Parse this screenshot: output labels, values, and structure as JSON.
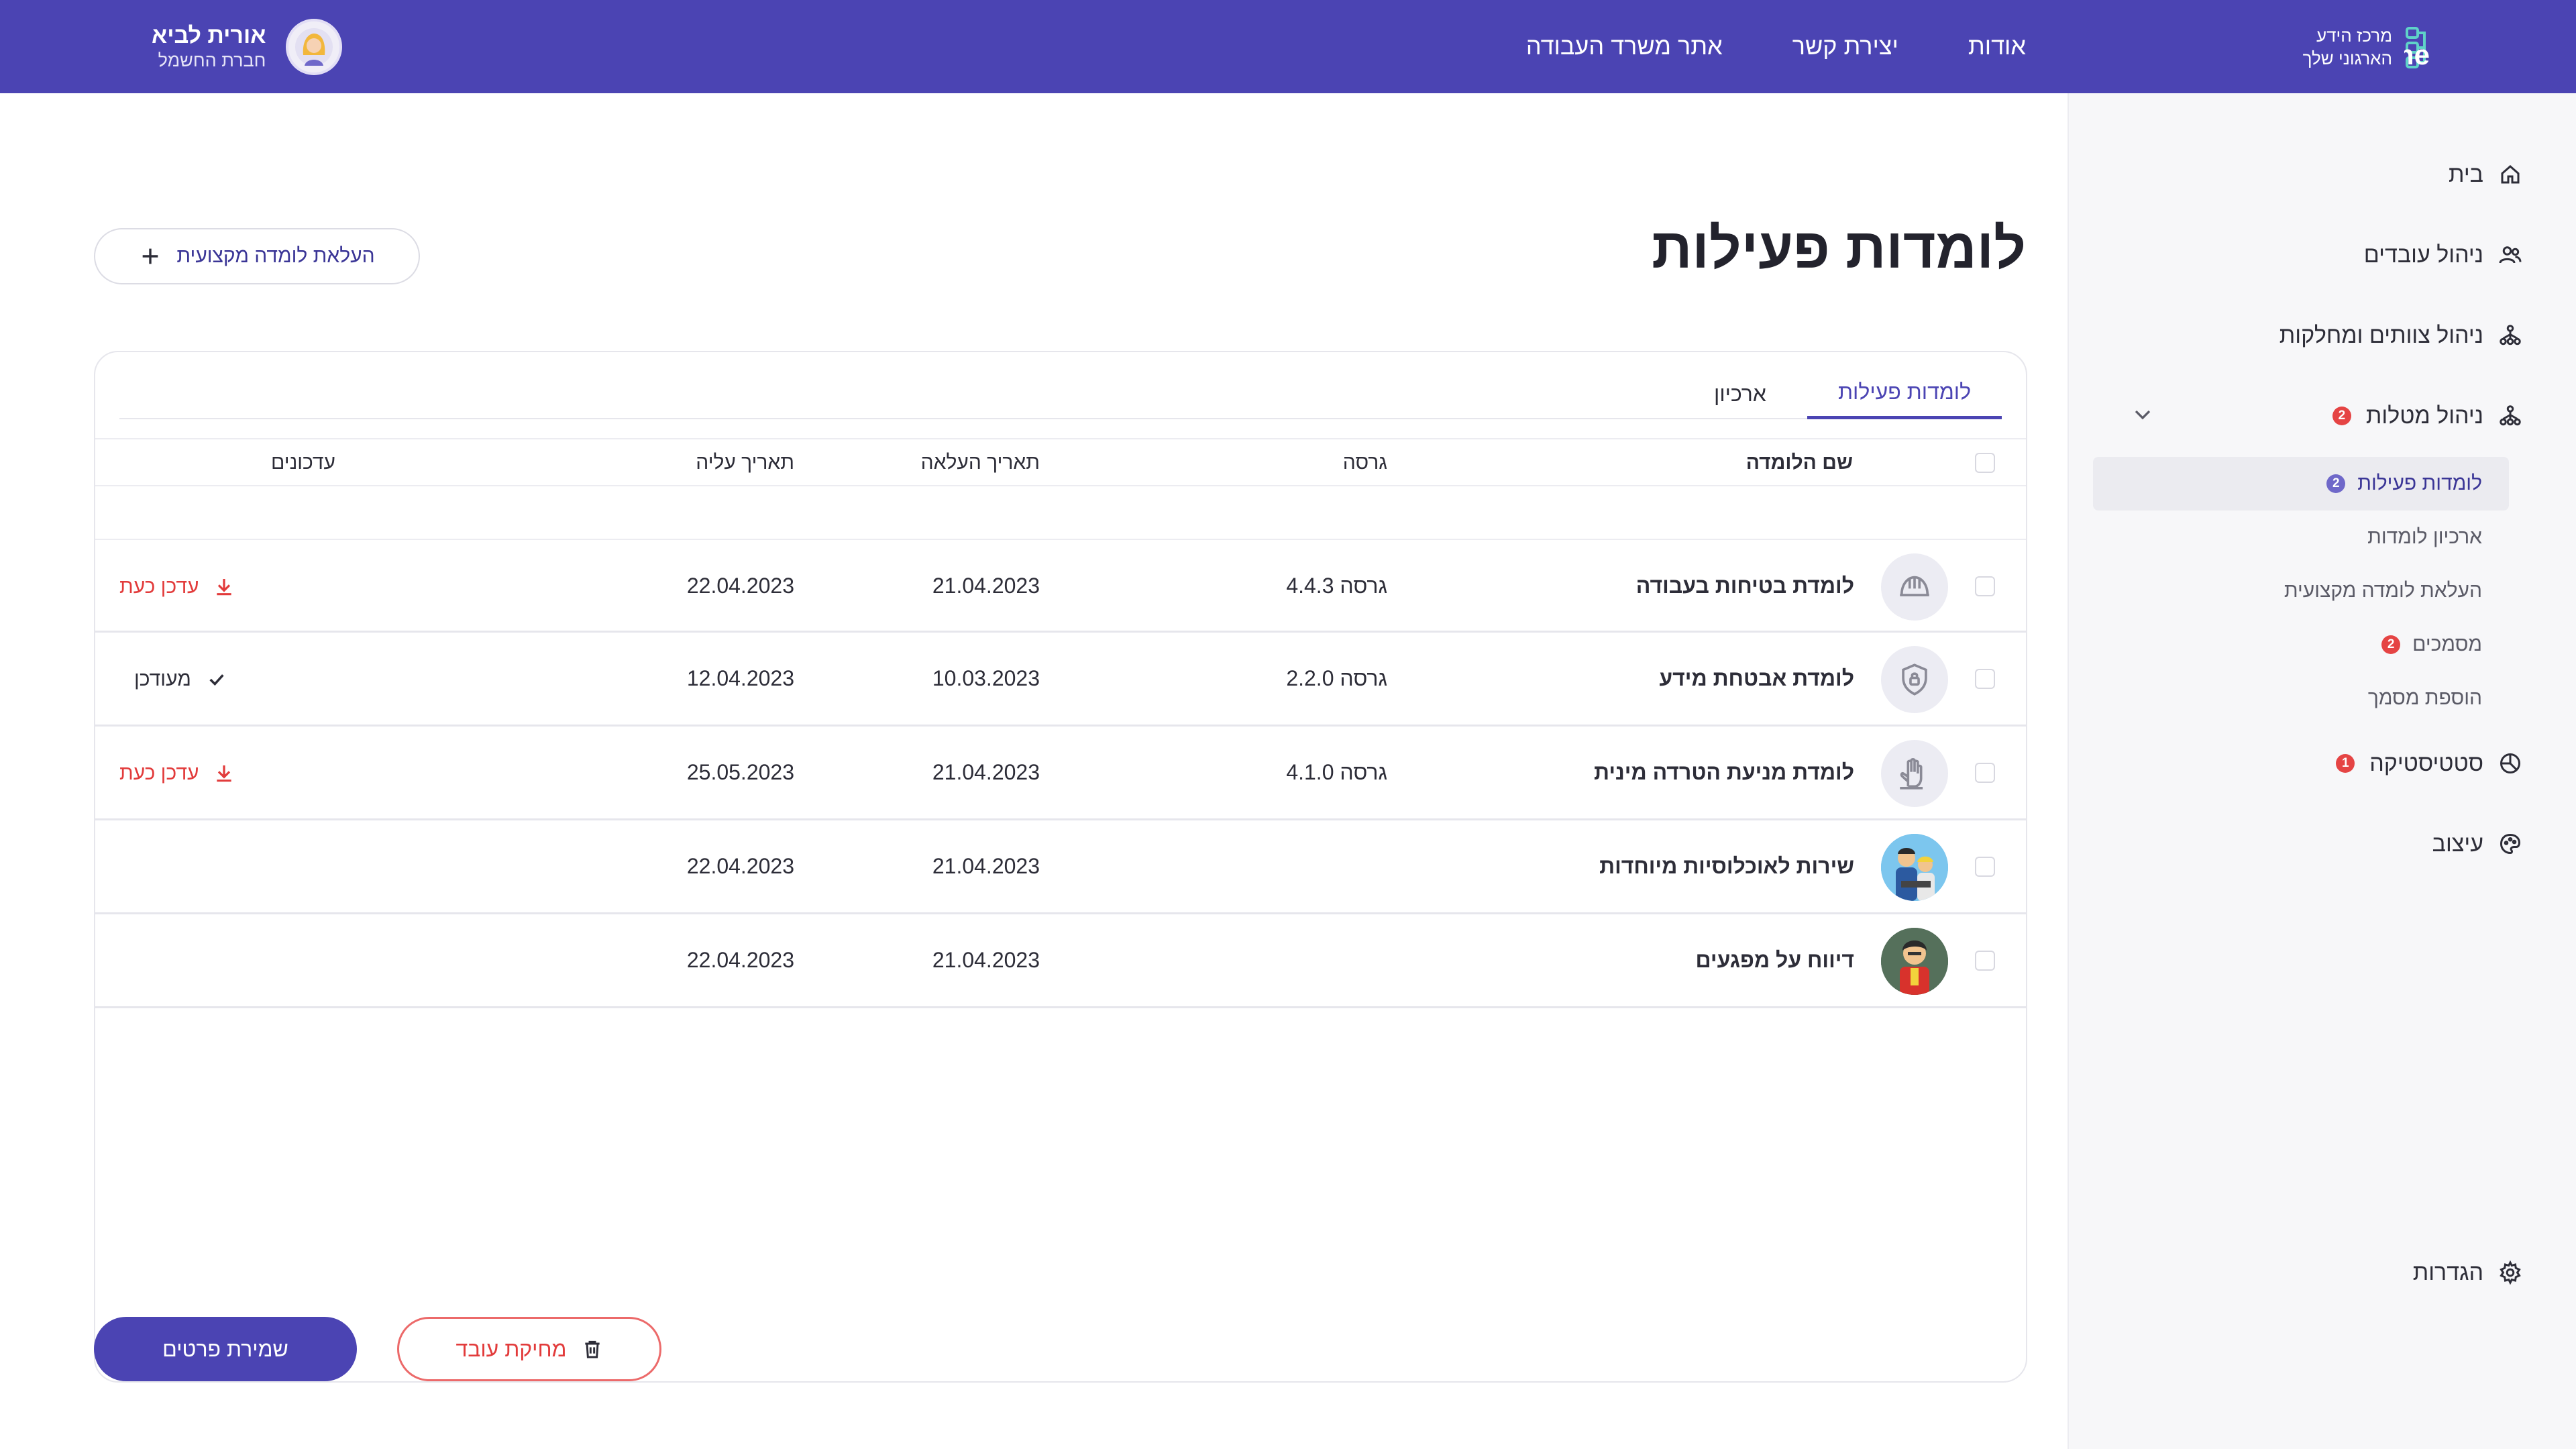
{
  "header": {
    "brand_line1": "מרכז הידע",
    "brand_line2": "הארגוני שלך",
    "nav": [
      "אודות",
      "יצירת קשר",
      "אתר משרד העבודה"
    ],
    "user_name": "אורית לביא",
    "user_company": "חברת החשמל",
    "bg_color": "#4b44b3"
  },
  "sidebar": {
    "items": [
      {
        "label": "בית",
        "icon": "home-icon"
      },
      {
        "label": "ניהול עובדים",
        "icon": "users-icon"
      },
      {
        "label": "ניהול צוותים ומחלקות",
        "icon": "hierarchy-icon"
      },
      {
        "label": "ניהול מטלות",
        "icon": "tasks-icon",
        "badge": "2"
      },
      {
        "label": "סטטיסטיקה",
        "icon": "statistics-icon",
        "badge": "1"
      },
      {
        "label": "עיצוב",
        "icon": "palette-icon"
      },
      {
        "label": "הגדרות",
        "icon": "gear-icon"
      }
    ],
    "sub_items": [
      {
        "label": "לומדות פעילות",
        "badge": "2",
        "active": true
      },
      {
        "label": "ארכיון לומדות"
      },
      {
        "label": "העלאת לומדה מקצועית"
      },
      {
        "label": "מסמכים",
        "badge": "2"
      },
      {
        "label": "הוספת מסמך"
      }
    ]
  },
  "main": {
    "title": "לומדות פעילות",
    "upload_button": "העלאת לומדה מקצועית",
    "tabs": [
      "לומדות פעילות",
      "ארכיון"
    ],
    "columns": {
      "name": "שם הלומדה",
      "version": "גרסה",
      "uploaded": "תאריך העלאה",
      "uplift": "תאריך עליה",
      "updates": "עדכונים"
    },
    "rows": [
      {
        "name": "לומדת בטיחות בעבודה",
        "icon": "helmet-icon",
        "version": "גרסה 4.4.3",
        "uploaded": "21.04.2023",
        "uplift": "22.04.2023",
        "update": "עדכן כעת",
        "status": "pending"
      },
      {
        "name": "לומדת אבטחת מידע",
        "icon": "shield-lock-icon",
        "version": "גרסה 2.2.0",
        "uploaded": "10.03.2023",
        "uplift": "12.04.2023",
        "update": "מעודכן",
        "status": "done"
      },
      {
        "name": "לומדת מניעת הטרדה מינית",
        "icon": "stop-hand-icon",
        "version": "גרסה 4.1.0",
        "uploaded": "21.04.2023",
        "uplift": "25.05.2023",
        "update": "עדכן כעת",
        "status": "pending"
      },
      {
        "name": "שירות לאוכלוסיות מיוחדות",
        "icon": "people-illustration-icon",
        "version": "",
        "uploaded": "21.04.2023",
        "uplift": "22.04.2023",
        "update": "",
        "status": "none"
      },
      {
        "name": "דיווח על מפגעים",
        "icon": "worker-illustration-icon",
        "version": "",
        "uploaded": "21.04.2023",
        "uplift": "22.04.2023",
        "update": "",
        "status": "none"
      }
    ],
    "save_button": "שמירת פרטים",
    "delete_button": "מחיקת עובד",
    "accent_color": "#4b44b3",
    "alert_color": "#e23b3b"
  }
}
